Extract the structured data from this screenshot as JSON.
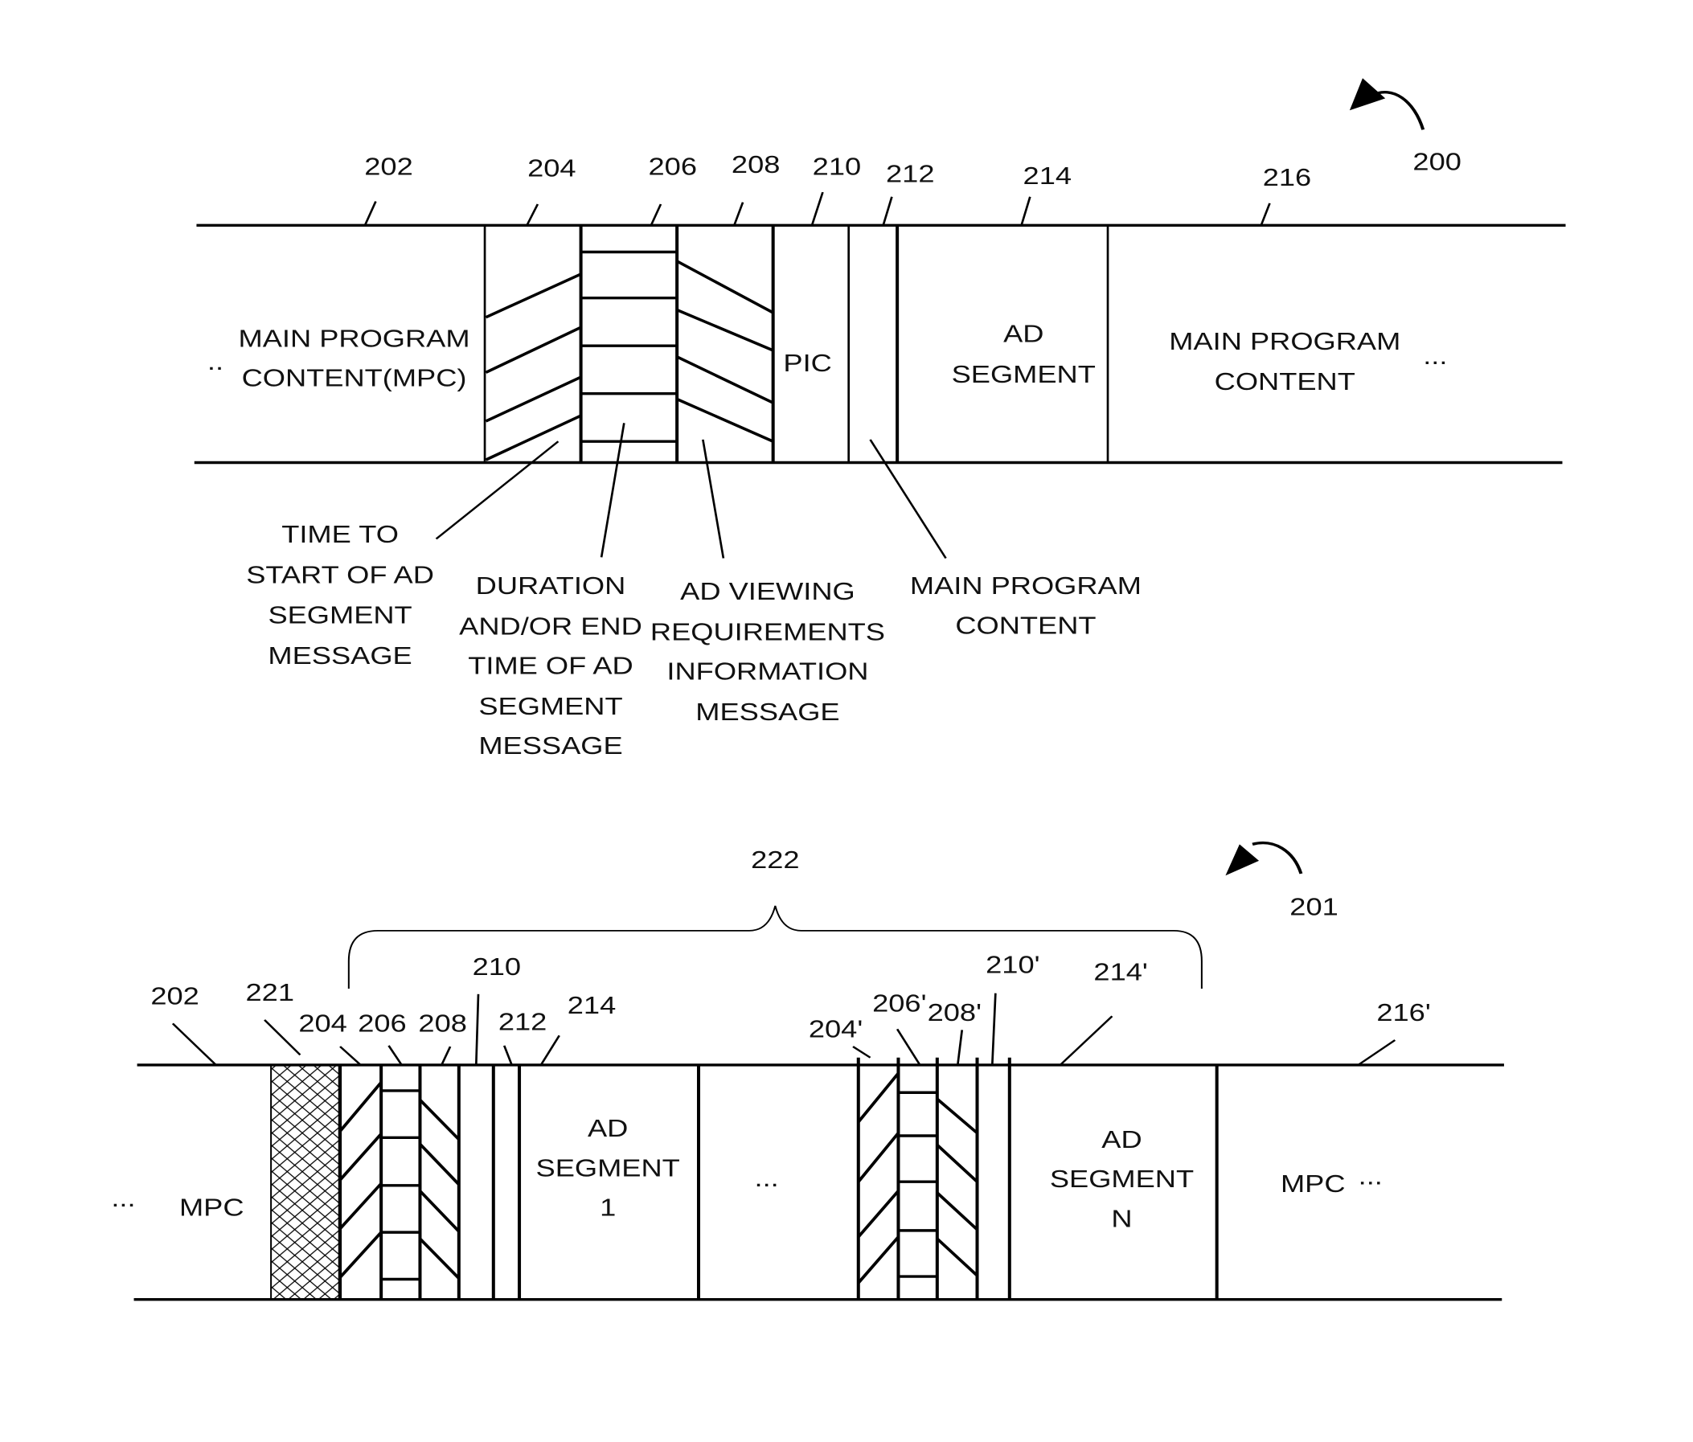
{
  "figure_200": {
    "ref": "200",
    "refs_top": [
      "202",
      "204",
      "206",
      "208",
      "210",
      "212",
      "214",
      "216"
    ],
    "mpc_left": [
      "MAIN PROGRAM",
      "CONTENT(MPC)"
    ],
    "ellipsis_left": "..",
    "pic": "PIC",
    "ad_segment": [
      "AD",
      "SEGMENT"
    ],
    "mpc_right": [
      "MAIN PROGRAM",
      "CONTENT"
    ],
    "ellipsis_right": "...",
    "callouts": {
      "time_to_start": [
        "TIME TO",
        "START OF AD",
        "SEGMENT",
        "MESSAGE"
      ],
      "duration": [
        "DURATION",
        "AND/OR END",
        "TIME OF AD",
        "SEGMENT",
        "MESSAGE"
      ],
      "viewing_req": [
        "AD VIEWING",
        "REQUIREMENTS",
        "INFORMATION",
        "MESSAGE"
      ],
      "main_program": [
        "MAIN PROGRAM",
        "CONTENT"
      ]
    }
  },
  "figure_201": {
    "ref": "201",
    "brace_ref": "222",
    "refs": {
      "r202": "202",
      "r221": "221",
      "r204": "204",
      "r206": "206",
      "r208": "208",
      "r210": "210",
      "r212": "212",
      "r214": "214",
      "r204p": "204'",
      "r206p": "206'",
      "r208p": "208'",
      "r210p": "210'",
      "r214p": "214'",
      "r216p": "216'"
    },
    "mpc_left": "MPC",
    "ellipsis_left": "...",
    "ad_segment_1": [
      "AD",
      "SEGMENT",
      "1"
    ],
    "ellipsis_mid": "...",
    "ad_segment_n": [
      "AD",
      "SEGMENT",
      "N"
    ],
    "mpc_right": "MPC",
    "ellipsis_right": "..."
  }
}
